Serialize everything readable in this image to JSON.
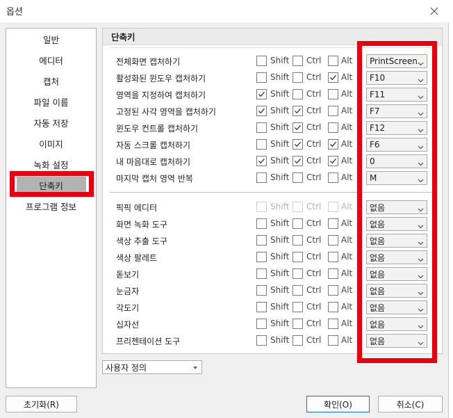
{
  "window": {
    "title": "옵션"
  },
  "sidebar": {
    "items": [
      {
        "label": "일반"
      },
      {
        "label": "에디터"
      },
      {
        "label": "캡처"
      },
      {
        "label": "파일 이름"
      },
      {
        "label": "자동 저장"
      },
      {
        "label": "이미지"
      },
      {
        "label": "녹화 설정"
      },
      {
        "label": "단축키",
        "selected": true
      },
      {
        "label": "프로그램 정보"
      }
    ]
  },
  "panel": {
    "header": "단축키"
  },
  "modifiers": {
    "shift": "Shift",
    "ctrl": "Ctrl",
    "alt": "Alt"
  },
  "rows": [
    {
      "label": "전체화면 캡처하기",
      "shift": false,
      "ctrl": false,
      "alt": false,
      "key": "PrintScreen"
    },
    {
      "label": "활성화된 윈도우 캡처하기",
      "shift": false,
      "ctrl": false,
      "alt": true,
      "key": "F10"
    },
    {
      "label": "영역을 지정하여 캡처하기",
      "shift": true,
      "ctrl": false,
      "alt": false,
      "key": "F11"
    },
    {
      "label": "고정된 사각 영역을 캡처하기",
      "shift": true,
      "ctrl": true,
      "alt": false,
      "key": "F7"
    },
    {
      "label": "윈도우 컨트롤 캡처하기",
      "shift": false,
      "ctrl": true,
      "alt": false,
      "key": "F12"
    },
    {
      "label": "자동 스크롤 캡처하기",
      "shift": false,
      "ctrl": true,
      "alt": true,
      "key": "F6"
    },
    {
      "label": "내 마음대로 캡처하기",
      "shift": true,
      "ctrl": true,
      "alt": true,
      "key": "0"
    },
    {
      "label": "마지막 캡처 영역 반복",
      "shift": false,
      "ctrl": false,
      "alt": false,
      "key": "M"
    },
    {
      "label": "픽픽 에디터",
      "shift": false,
      "ctrl": false,
      "alt": false,
      "key": "없음",
      "disabled": true
    },
    {
      "label": "화면 녹화 도구",
      "shift": false,
      "ctrl": false,
      "alt": false,
      "key": "없음"
    },
    {
      "label": "색상 추출 도구",
      "shift": false,
      "ctrl": false,
      "alt": false,
      "key": "없음"
    },
    {
      "label": "색상 팔레트",
      "shift": false,
      "ctrl": false,
      "alt": false,
      "key": "없음"
    },
    {
      "label": "돋보기",
      "shift": false,
      "ctrl": false,
      "alt": false,
      "key": "없음"
    },
    {
      "label": "눈금자",
      "shift": false,
      "ctrl": false,
      "alt": false,
      "key": "없음"
    },
    {
      "label": "각도기",
      "shift": false,
      "ctrl": false,
      "alt": false,
      "key": "없음"
    },
    {
      "label": "십자선",
      "shift": false,
      "ctrl": false,
      "alt": false,
      "key": "없음"
    },
    {
      "label": "프리젠테이션 도구",
      "shift": false,
      "ctrl": false,
      "alt": false,
      "key": "없음"
    }
  ],
  "preset": {
    "value": "사용자 정의"
  },
  "buttons": {
    "reset": "초기화(R)",
    "ok": "확인(O)",
    "cancel": "취소(C)"
  },
  "colors": {
    "highlight": "#e8000e",
    "selected_bg": "#b3b3b3"
  }
}
